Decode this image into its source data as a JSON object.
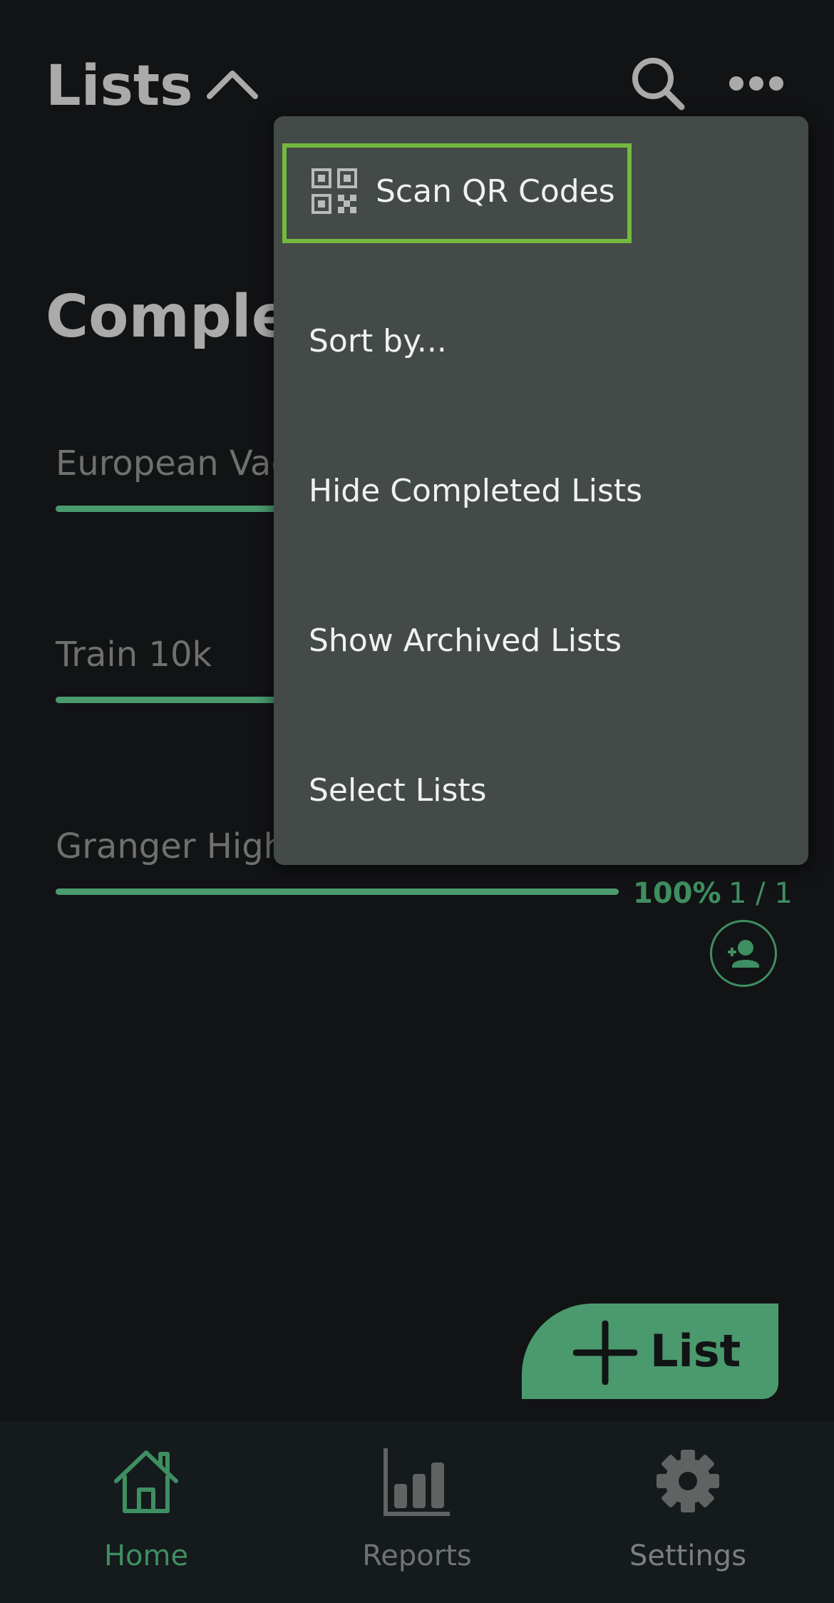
{
  "header": {
    "title": "Lists",
    "icons": [
      "chevron-up-icon",
      "search-icon",
      "more-horizontal-icon"
    ]
  },
  "section_title": "Complet",
  "lists": [
    {
      "name": "European Vac",
      "progress": 1.0
    },
    {
      "name": "Train 10k",
      "progress": 1.0
    },
    {
      "name": "Granger High",
      "progress": 1.0,
      "percent": "100%",
      "count": "1 / 1"
    }
  ],
  "menu": {
    "items": [
      {
        "label": "Scan QR Codes",
        "icon": "qr-code-icon",
        "highlighted": true
      },
      {
        "label": "Sort by..."
      },
      {
        "label": "Hide Completed Lists"
      },
      {
        "label": "Show Archived Lists"
      },
      {
        "label": "Select Lists"
      }
    ]
  },
  "fab": {
    "label": "List",
    "icon": "plus-icon"
  },
  "bottom_nav": [
    {
      "label": "Home",
      "icon": "home-icon",
      "active": true
    },
    {
      "label": "Reports",
      "icon": "bar-chart-icon",
      "active": false
    },
    {
      "label": "Settings",
      "icon": "gear-icon",
      "active": false
    }
  ],
  "colors": {
    "background": "#121315",
    "accent": "#4a9a6e",
    "menu_bg": "#434a47",
    "highlight": "#73b93e"
  }
}
